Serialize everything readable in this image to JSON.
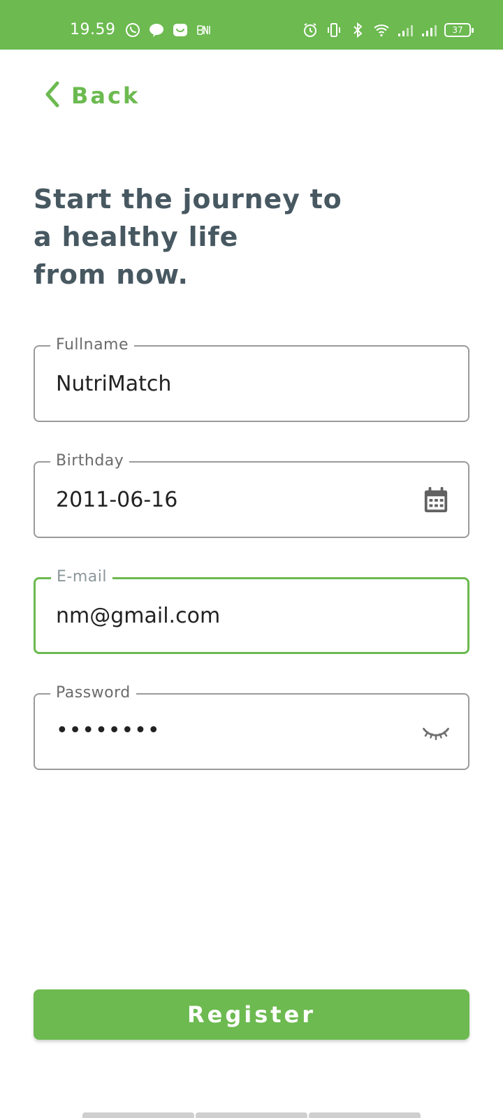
{
  "status_bar": {
    "time": "19.59",
    "battery": "37",
    "left_icons": [
      "whatsapp-icon",
      "line-icon",
      "message-icon",
      "bni-icon"
    ],
    "right_icons": [
      "alarm-icon",
      "vibrate-icon",
      "bluetooth-icon",
      "wifi-icon",
      "signal-icon",
      "signal-icon"
    ]
  },
  "header": {
    "back_label": "Back"
  },
  "headline": {
    "line1": "Start the journey to",
    "line2": "a healthy life",
    "line3": "from now."
  },
  "form": {
    "fullname": {
      "label": "Fullname",
      "value": "NutriMatch"
    },
    "birthday": {
      "label": "Birthday",
      "value": "2011-06-16",
      "icon": "calendar-icon"
    },
    "email": {
      "label": "E-mail",
      "value": "nm@gmail.com",
      "focused": true
    },
    "password": {
      "label": "Password",
      "value": "••••••••",
      "icon": "eye-closed-icon"
    }
  },
  "actions": {
    "register_label": "Register"
  },
  "colors": {
    "accent": "#6cba50",
    "headline": "#475861",
    "border": "#9a9a9a"
  }
}
